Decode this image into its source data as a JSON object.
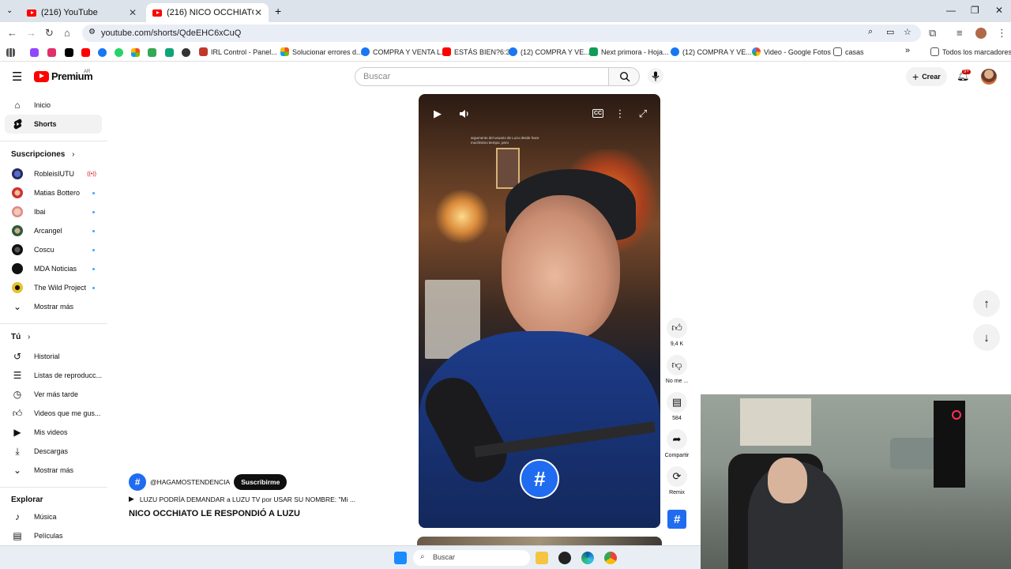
{
  "browser": {
    "tabs": [
      {
        "title": "(216) YouTube",
        "active": false
      },
      {
        "title": "(216) NICO OCCHIATO LE RESP",
        "active": true
      }
    ],
    "url": "youtube.com/shorts/QdeEHC6xCuQ",
    "bookmarks": [
      {
        "label": "IRL Control - Panel..."
      },
      {
        "label": "Solucionar errores d..."
      },
      {
        "label": "COMPRA Y VENTA L..."
      },
      {
        "label": "ESTÁS BIEN?6:33"
      },
      {
        "label": "(12) COMPRA Y VE..."
      },
      {
        "label": "Next primora - Hoja..."
      },
      {
        "label": "(12) COMPRA Y VE..."
      },
      {
        "label": "Video - Google Fotos"
      },
      {
        "label": "casas"
      }
    ],
    "all_bookmarks": "Todos los marcadores"
  },
  "header": {
    "logo_text": "Premium",
    "country": "AR",
    "search_placeholder": "Buscar",
    "create_label": "Crear",
    "notifications_badge": "9+"
  },
  "sidebar": {
    "main": [
      {
        "label": "Inicio",
        "icon": "home-icon"
      },
      {
        "label": "Shorts",
        "icon": "shorts-icon",
        "selected": true
      }
    ],
    "subscriptions_title": "Suscripciones",
    "subscriptions": [
      {
        "label": "RobleisIUTU",
        "live": true
      },
      {
        "label": "Matias Bottero"
      },
      {
        "label": "Ibai"
      },
      {
        "label": "Arcangel"
      },
      {
        "label": "Coscu"
      },
      {
        "label": "MDA Noticias"
      },
      {
        "label": "The Wild Project"
      }
    ],
    "show_more": "Mostrar más",
    "you_title": "Tú",
    "you_items": [
      {
        "label": "Historial"
      },
      {
        "label": "Listas de reproducc..."
      },
      {
        "label": "Ver más tarde"
      },
      {
        "label": "Videos que me gus..."
      },
      {
        "label": "Mis videos"
      },
      {
        "label": "Descargas"
      },
      {
        "label": "Mostrar más"
      }
    ],
    "explore_title": "Explorar",
    "explore_items": [
      {
        "label": "Música"
      },
      {
        "label": "Películas"
      }
    ]
  },
  "short": {
    "caption": "argumento del usuario de Luzu desde hace muchísimo tiempo, pero",
    "channel": "@HAGAMOSTENDENCIA",
    "subscribe_label": "Suscribirme",
    "music": "LUZU PODRÍA DEMANDAR a LUZU TV por USAR SU NOMBRE: \"Mi ...",
    "title": "NICO OCCHIATO LE RESPONDIÓ A LUZU",
    "actions": {
      "like": "9,4 K",
      "dislike": "No me ...",
      "comments": "584",
      "share": "Compartir",
      "remix": "Remix"
    }
  },
  "taskbar": {
    "search_label": "Buscar"
  },
  "colors": {
    "youtube_red": "#ff0000",
    "channel_blue": "#1f6cf0"
  }
}
